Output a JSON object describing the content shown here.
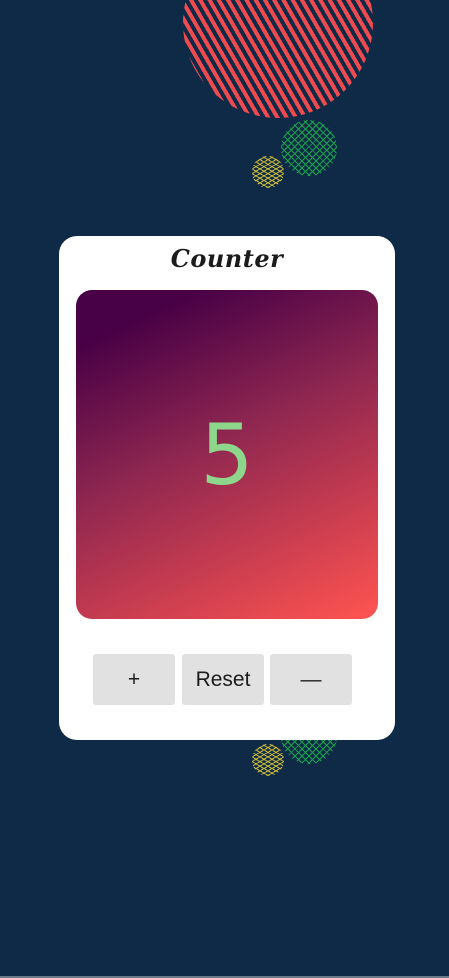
{
  "counter": {
    "title": "Counter",
    "value": "5"
  },
  "buttons": {
    "increment_label": "+",
    "reset_label": "Reset",
    "decrement_label": "—"
  },
  "colors": {
    "background": "#0f2a47",
    "card": "#ffffff",
    "count_text": "#8ed68b",
    "button": "#e0e1e0",
    "gradient_start": "#480046",
    "gradient_end": "#ff5450"
  }
}
